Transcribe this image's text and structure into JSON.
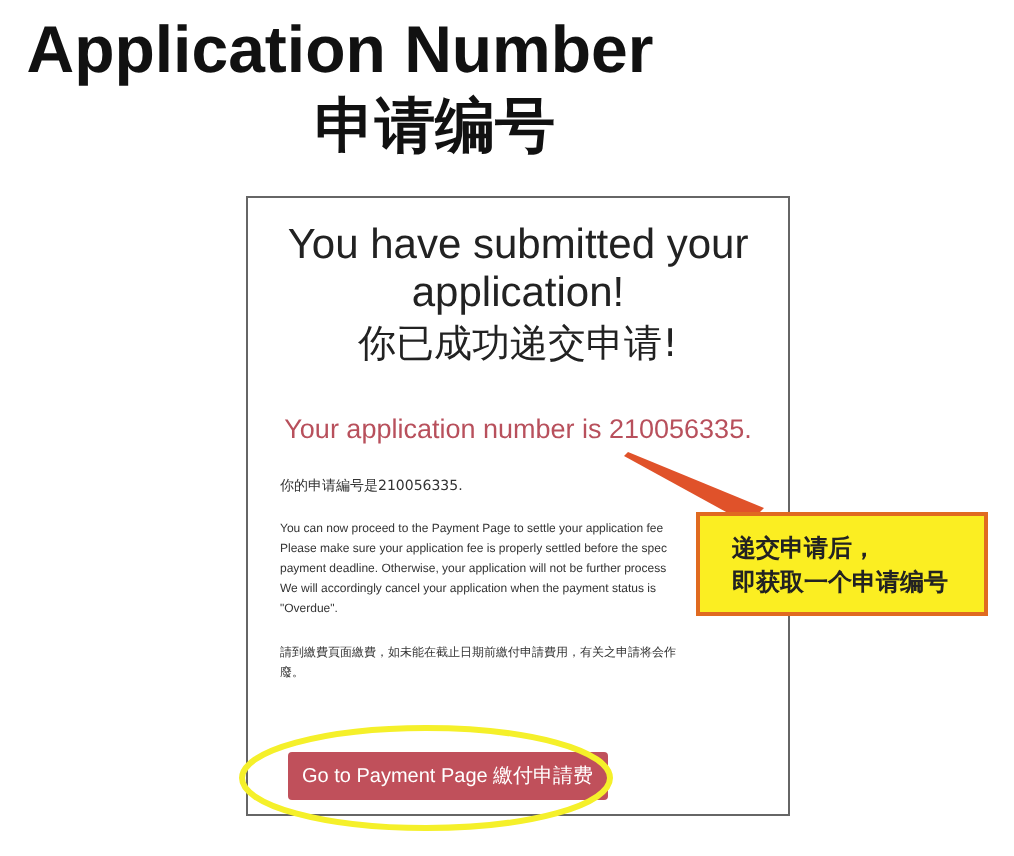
{
  "slide_title": "Application Number",
  "slide_subtitle": "申请编号",
  "screenshot": {
    "heading": "You have submitted your application!",
    "heading_zh": "你已成功递交申请!",
    "number_line": "Your application number is 210056335.",
    "number_line_zh": "你的申请編号是210056335.",
    "paragraph_lines": [
      "You can now proceed to the Payment Page to settle your application fee",
      "Please make sure your application fee is properly settled before the spec",
      "payment deadline. Otherwise, your application will not be further process",
      "We will accordingly cancel your application when the payment status is",
      "\"Overdue\"."
    ],
    "paragraph_zh_lines": [
      "請到繳費頁面繳費，如未能在截止日期前繳付申請費用，有关之申請将会作",
      "廢。"
    ],
    "button": "Go to Payment Page 繳付申請费"
  },
  "callout": {
    "lines": [
      "递交申请后，",
      "即获取一个申请编号"
    ]
  }
}
